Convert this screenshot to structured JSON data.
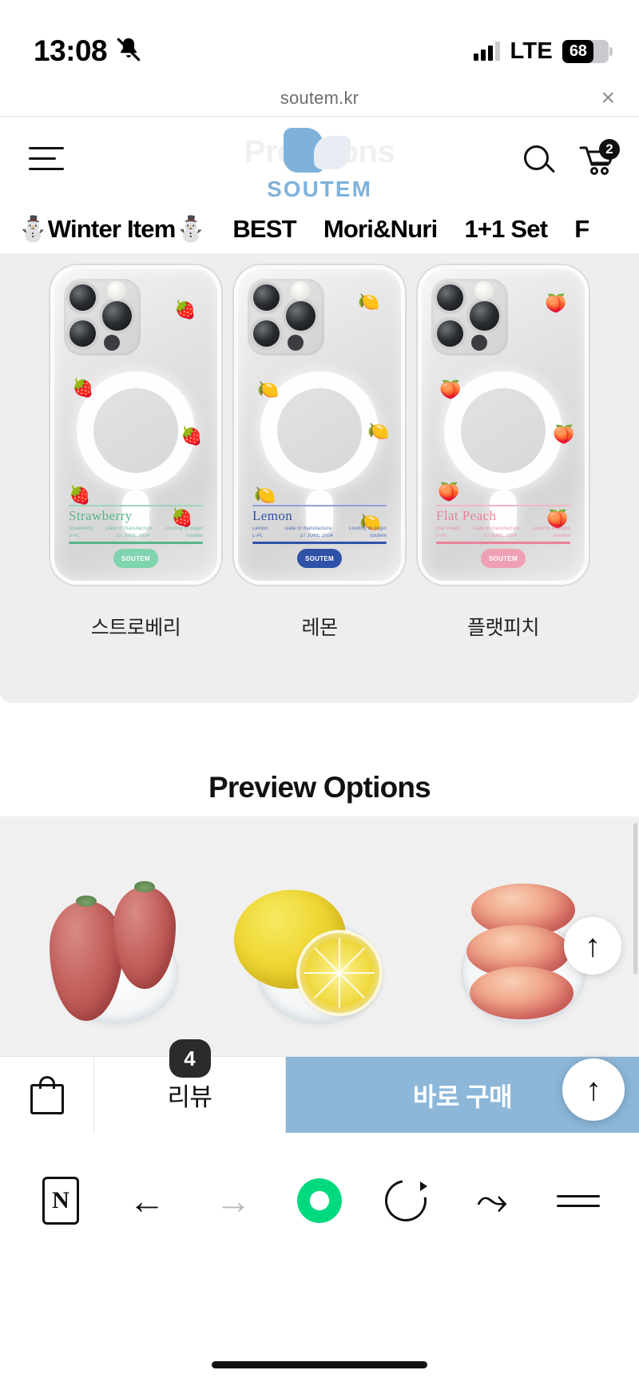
{
  "status_bar": {
    "time": "13:08",
    "mute_icon": "bell-slash-icon",
    "network": "LTE",
    "battery_percent": "68",
    "signal_icon": "signal-bars-icon"
  },
  "browser": {
    "url": "soutem.kr",
    "close_label": "×",
    "toolbar": {
      "naver_label": "N",
      "back_icon": "←",
      "forward_icon": "→",
      "home_icon": "green-ring-icon",
      "reload_icon": "reload-icon",
      "share_icon": "⤳",
      "menu_icon": "hamburger-menu-icon"
    }
  },
  "site_header": {
    "menu_icon": "hamburger-menu-icon",
    "logo_text": "SOUTEM",
    "search_icon": "search-icon",
    "cart_icon": "cart-icon",
    "cart_count": "2",
    "ghost_heading": "Prev          tions"
  },
  "nav": {
    "items": [
      {
        "label": "⛄Winter Item⛄"
      },
      {
        "label": "BEST"
      },
      {
        "label": "Mori&Nuri"
      },
      {
        "label": "1+1 Set"
      },
      {
        "label": "F"
      }
    ]
  },
  "product_panel": {
    "cases": [
      {
        "caption": "스트로베리",
        "label_name": "Strawberry",
        "label_cols": [
          "Strawberry",
          "Date of manufacture",
          "Country of origin"
        ],
        "label_values": [
          "S-PL",
          "27 JUNE 2024",
          "soutem"
        ],
        "stamp": "SOUTEM",
        "accent": "#57b58c",
        "fruit_emoji": "🍓"
      },
      {
        "caption": "레몬",
        "label_name": "Lemon",
        "label_cols": [
          "Lemon",
          "Date of manufacture",
          "Country of origin"
        ],
        "label_values": [
          "L-PL",
          "27 JUNE 2024",
          "soutem"
        ],
        "stamp": "SOUTEM",
        "accent": "#2f52a8",
        "fruit_emoji": "🍋"
      },
      {
        "caption": "플랫피치",
        "label_name": "Flat Peach",
        "label_cols": [
          "Flat Peach",
          "Date of manufacture",
          "Country of origin"
        ],
        "label_values": [
          "F-PL",
          "27 JUNE 2024",
          "soutem"
        ],
        "stamp": "SOUTEM",
        "accent": "#e8829c",
        "fruit_emoji": "🍑"
      }
    ]
  },
  "section": {
    "title": "Preview Options"
  },
  "photo_strip": {
    "items": [
      {
        "alt": "strawberry-photo"
      },
      {
        "alt": "lemon-photo"
      },
      {
        "alt": "flat-peach-photo"
      }
    ],
    "scroll_top_icon": "↑"
  },
  "action_bar": {
    "bag_icon": "shopping-bag-icon",
    "review_label": "리뷰",
    "review_count": "4",
    "buy_label": "바로 구매",
    "scroll_top_icon": "↑"
  },
  "colors": {
    "brand_blue": "#7fb2db",
    "buy_button": "#8cb7d9",
    "panel_gray": "#eeeeee",
    "badge_dark": "#2b2b2b",
    "naver_green": "#00d97e"
  }
}
